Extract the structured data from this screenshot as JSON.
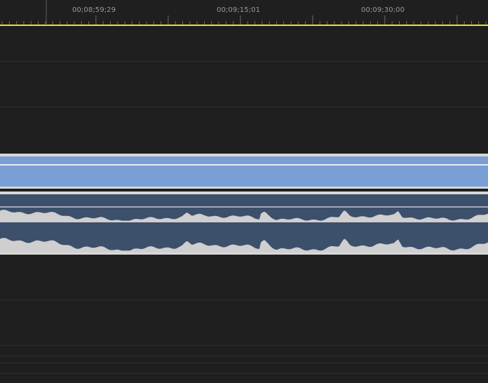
{
  "timeline": {
    "timecodes": [
      "00;08;59;29",
      "00;09;15;01",
      "00;09;30;00"
    ],
    "playhead_color": "#f0e020",
    "video_clip_color": "#7a9fd4",
    "audio_clip_color": "#3c4f6b",
    "waveform_color": "#cfcfcf"
  },
  "icons": {
    "playhead": "playhead-line-icon"
  }
}
